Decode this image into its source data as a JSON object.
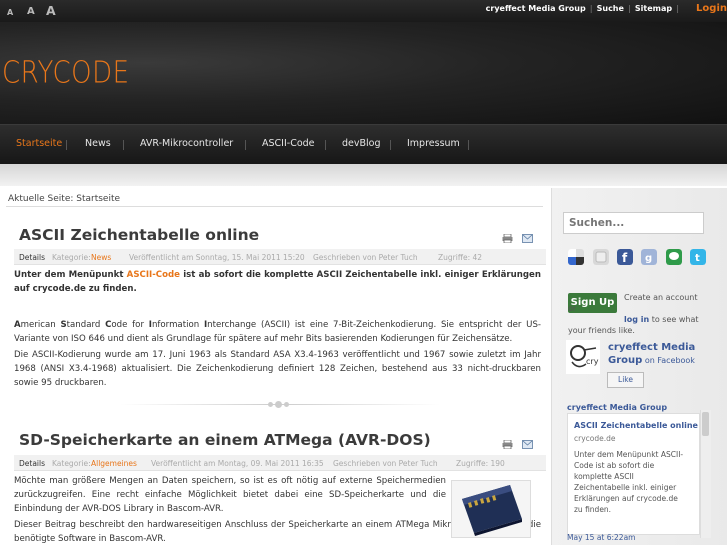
{
  "font_sizes": [
    "A",
    "A",
    "A"
  ],
  "top_links": [
    "cryeffect Media Group",
    "Suche",
    "Sitemap"
  ],
  "login": "Login",
  "logo": "CRYCODE",
  "nav": [
    "Startseite",
    "News",
    "AVR-Mikrocontroller",
    "ASCII-Code",
    "devBlog",
    "Impressum"
  ],
  "breadcrumb": "Aktuelle Seite: Startseite",
  "articles": [
    {
      "title": "ASCII Zeichentabelle online",
      "details": "Details",
      "category_label": "Kategorie:",
      "category": "News",
      "published": "Veröffentlicht am Sonntag, 15. Mai 2011 15:20",
      "author": "Geschrieben von Peter Tuch",
      "hits": "Zugriffe: 42",
      "intro_a": "Unter dem Menüpunkt ",
      "intro_link": "ASCII-Code",
      "intro_b": " ist ab sofort die komplette ASCII Zeichentabelle inkl. einiger Erklärungen auf crycode.de zu finden.",
      "p1_b1": "A",
      "p1_t1": "merican ",
      "p1_b2": "S",
      "p1_t2": "tandard ",
      "p1_b3": "C",
      "p1_t3": "ode for ",
      "p1_b4": "I",
      "p1_t4": "nformation ",
      "p1_b5": "I",
      "p1_t5": "nterchange (ASCII) ist eine 7-Bit-Zeichenkodierung. Sie entspricht der US-Variante von ISO 646 und dient als Grundlage für spätere auf mehr Bits basierenden Kodierungen für Zeichensätze.",
      "p2": "Die ASCII-Kodierung wurde am 17. Juni 1963 als Standard ASA X3.4-1963 veröffentlicht und 1967 sowie zuletzt im Jahr 1968 (ANSI X3.4-1968) aktualisiert. Die Zeichenkodierung definiert 128 Zeichen, bestehend aus 33 nicht-druckbaren sowie 95 druckbaren."
    },
    {
      "title": "SD-Speicherkarte an einem ATMega (AVR-DOS)",
      "details": "Details",
      "category_label": "Kategorie:",
      "category": "Allgemeines",
      "published": "Veröffentlicht am Montag, 09. Mai 2011 16:35",
      "author": "Geschrieben von Peter Tuch",
      "hits": "Zugriffe: 190",
      "p1": "Möchte man größere Mengen an Daten speichern, so ist es oft nötig auf externe Speichermedien zurückzugreifen. Eine recht einfache Möglichkeit bietet dabei eine SD-Speicherkarte und die Einbindung der AVR-DOS Library in Bascom-AVR.",
      "p2": "Dieser Beitrag beschreibt den hardwareseitigen Anschluss der Speicherkarte an einem ATMega Mikrocontroller sowie die benötigte Software in Bascom-AVR."
    }
  ],
  "sidebar": {
    "search_placeholder": "Suchen...",
    "social_icons": [
      "delicious-icon",
      "digg-icon",
      "facebook-icon",
      "google-icon",
      "chat-icon",
      "twitter-icon"
    ],
    "signup_button": "Sign Up",
    "signup_text_a": "Create an account or ",
    "signup_login": "log in",
    "signup_text_b": " to see what your friends like.",
    "fb_page": "cryeffect Media Group",
    "fb_on": " on Facebook",
    "like": "Like",
    "feed_title": "cryeffect Media Group",
    "feed_item_title": "ASCII Zeichentabelle online",
    "feed_item_source": "crycode.de",
    "feed_item_body": "Unter dem Menüpunkt ASCII-Code ist ab sofort die komplette ASCII Zeichentabelle inkl. einiger Erklärungen auf crycode.de zu finden.",
    "feed_date": "May 15 at 6:22am"
  },
  "colors": {
    "accent": "#e8761a",
    "facebook": "#3b5998",
    "dark_bg": "#1a1a1a"
  }
}
